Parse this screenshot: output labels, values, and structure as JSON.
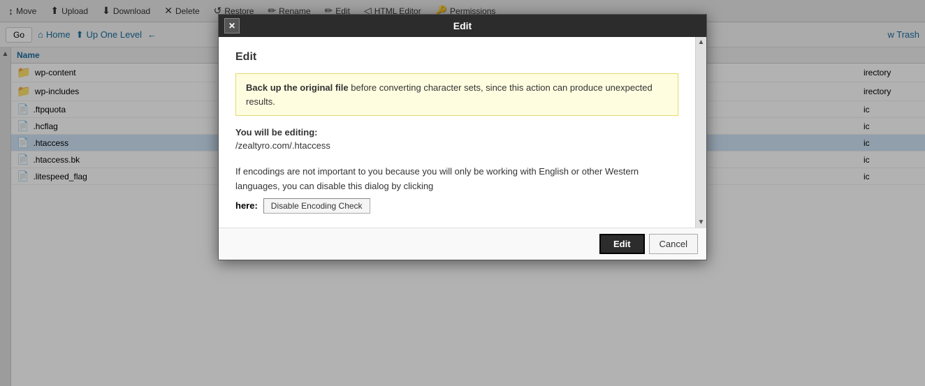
{
  "toolbar": {
    "buttons": [
      {
        "label": "Move",
        "icon": "↕"
      },
      {
        "label": "Upload",
        "icon": "⬆"
      },
      {
        "label": "Download",
        "icon": "⬇"
      },
      {
        "label": "Delete",
        "icon": "✕"
      },
      {
        "label": "Restore",
        "icon": "↺"
      },
      {
        "label": "Rename",
        "icon": "✏"
      },
      {
        "label": "Edit",
        "icon": "✏"
      },
      {
        "label": "HTML Editor",
        "icon": "◁"
      },
      {
        "label": "Permissions",
        "icon": "🔑"
      }
    ]
  },
  "navbar": {
    "go_label": "Go",
    "home_label": "Home",
    "up_level_label": "Up One Level",
    "trash_label": "w Trash"
  },
  "file_list": {
    "header": {
      "name": "Name"
    },
    "files": [
      {
        "name": "wp-content",
        "type": "folder",
        "selected": false
      },
      {
        "name": "wp-includes",
        "type": "folder",
        "selected": false
      },
      {
        "name": ".ftpquota",
        "type": "file",
        "selected": false
      },
      {
        "name": ".hcflag",
        "type": "file",
        "selected": false
      },
      {
        "name": ".htaccess",
        "type": "file",
        "selected": true
      },
      {
        "name": ".htaccess.bk",
        "type": "file",
        "selected": false
      },
      {
        "name": ".litespeed_flag",
        "type": "file",
        "selected": false
      }
    ],
    "right_labels": {
      "directory1": "irectory",
      "directory2": "irectory",
      "public1": "ic",
      "public2": "ic",
      "public3": "ic",
      "public4": "ic",
      "public5": "ic"
    }
  },
  "modal": {
    "title": "Edit",
    "close_icon": "✕",
    "heading": "Edit",
    "warning": {
      "bold_text": "Back up the original file",
      "rest_text": " before converting character sets, since this action can produce unexpected results."
    },
    "editing_label": "You will be editing:",
    "editing_path": "/zealtyro.com/.htaccess",
    "encoding_text_1": "If encodings are not important to you because you will only be working with English or other Western languages, you can disable this dialog by clicking",
    "here_label": "here:",
    "disable_btn_label": "Disable Encoding Check",
    "footer": {
      "edit_label": "Edit",
      "cancel_label": "Cancel"
    }
  }
}
